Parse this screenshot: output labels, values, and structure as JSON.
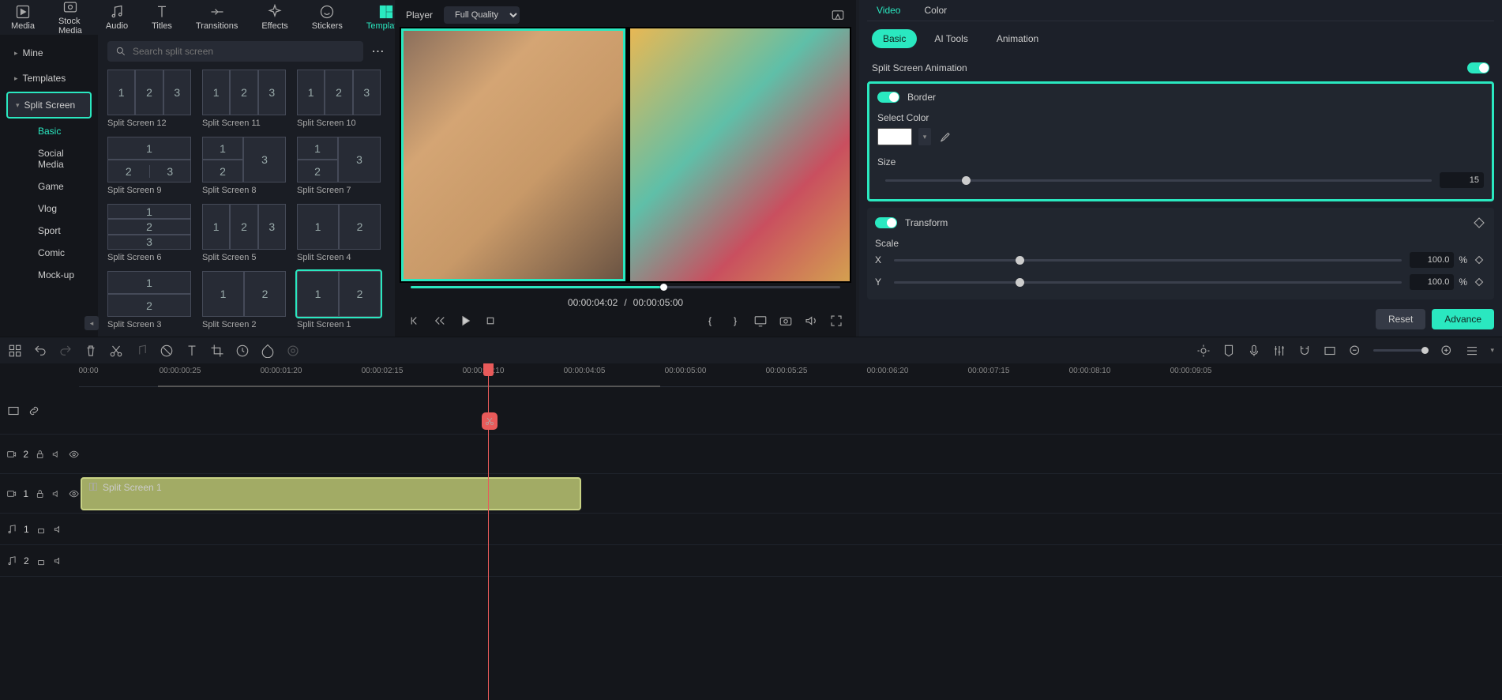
{
  "top_tabs": [
    "Media",
    "Stock Media",
    "Audio",
    "Titles",
    "Transitions",
    "Effects",
    "Stickers",
    "Templates"
  ],
  "active_top_tab": "Templates",
  "nav": {
    "mine": "Mine",
    "templates": "Templates",
    "split": "Split Screen"
  },
  "subnav": [
    "Basic",
    "Social Media",
    "Game",
    "Vlog",
    "Sport",
    "Comic",
    "Mock-up"
  ],
  "active_subnav": "Basic",
  "search_placeholder": "Search split screen",
  "templates": [
    "Split Screen 12",
    "Split Screen 11",
    "Split Screen 10",
    "Split Screen 9",
    "Split Screen 8",
    "Split Screen 7",
    "Split Screen 6",
    "Split Screen 5",
    "Split Screen 4",
    "Split Screen 3",
    "Split Screen 2",
    "Split Screen 1"
  ],
  "selected_template": "Split Screen 1",
  "player": {
    "title": "Player",
    "quality": "Full Quality",
    "current": "00:00:04:02",
    "total": "00:00:05:00"
  },
  "props_tabs": [
    "Video",
    "Color"
  ],
  "props_subtabs": [
    "Basic",
    "AI Tools",
    "Animation"
  ],
  "ssa_label": "Split Screen Animation",
  "border": {
    "label": "Border",
    "select_color": "Select Color",
    "size_label": "Size",
    "size_value": "15"
  },
  "transform": {
    "label": "Transform",
    "scale": "Scale",
    "x": "X",
    "y": "Y",
    "xval": "100.0",
    "yval": "100.0",
    "unit": "%"
  },
  "buttons": {
    "reset": "Reset",
    "advance": "Advance"
  },
  "ruler": [
    "00:00",
    "00:00:00:25",
    "00:00:01:20",
    "00:00:02:15",
    "00:00:03:10",
    "00:00:04:05",
    "00:00:05:00",
    "00:00:05:25",
    "00:00:06:20",
    "00:00:07:15",
    "00:00:08:10",
    "00:00:09:05"
  ],
  "clip_name": "Split Screen 1",
  "track_labels": {
    "v2": "2",
    "v1": "1",
    "a1": "1",
    "a2": "2"
  }
}
